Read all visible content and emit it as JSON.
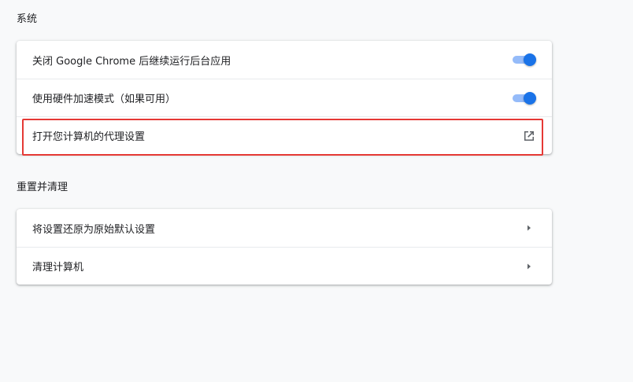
{
  "system_section": {
    "title": "系统",
    "items": [
      {
        "label": "关闭 Google Chrome 后继续运行后台应用",
        "control": "toggle",
        "checked": true
      },
      {
        "label": "使用硬件加速模式（如果可用）",
        "control": "toggle",
        "checked": true
      },
      {
        "label": "打开您计算机的代理设置",
        "control": "external-link",
        "icon": "open-in-new-icon"
      }
    ]
  },
  "reset_section": {
    "title": "重置并清理",
    "items": [
      {
        "label": "将设置还原为原始默认设置",
        "control": "arrow",
        "icon": "arrow-right-icon"
      },
      {
        "label": "清理计算机",
        "control": "arrow",
        "icon": "arrow-right-icon"
      }
    ]
  },
  "colors": {
    "toggle_on": "#1a73e8",
    "toggle_track": "#8ab4f8",
    "highlight": "#e53935"
  }
}
